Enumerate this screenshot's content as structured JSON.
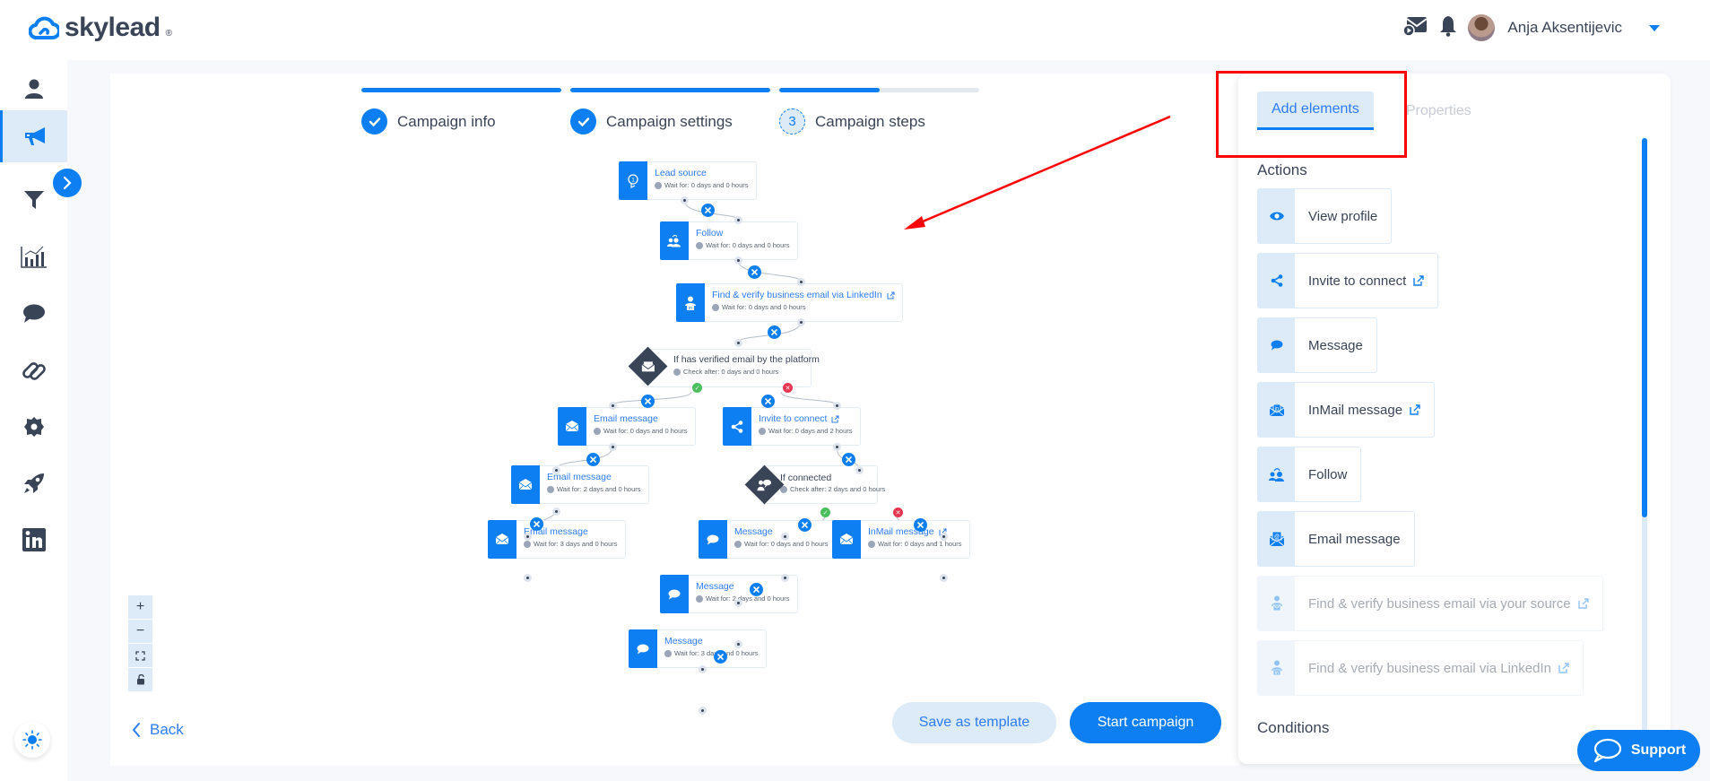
{
  "header": {
    "brand": "skylead",
    "brand_mark": "®",
    "user_name": "Anja Aksentijevic",
    "icons": [
      "mail-play-icon",
      "bell-icon",
      "avatar",
      "chevron-down-icon"
    ]
  },
  "sidebar": {
    "items": [
      {
        "name": "profile",
        "icon": "user-icon",
        "active": false
      },
      {
        "name": "campaigns",
        "icon": "megaphone-icon",
        "active": true
      },
      {
        "name": "filters",
        "icon": "funnel-icon",
        "active": false
      },
      {
        "name": "statistics",
        "icon": "chart-icon",
        "active": false
      },
      {
        "name": "inbox",
        "icon": "chat-icon",
        "active": false
      },
      {
        "name": "integrations",
        "icon": "paperclip-icon",
        "active": false
      },
      {
        "name": "settings",
        "icon": "gear-icon",
        "active": false
      },
      {
        "name": "launch",
        "icon": "rocket-icon",
        "active": false
      },
      {
        "name": "linkedin",
        "icon": "linkedin-icon",
        "active": false
      }
    ],
    "toggle_icon": "chevron-right-icon",
    "theme_icon": "sun-icon"
  },
  "stepper": {
    "steps": [
      {
        "label": "Campaign info",
        "state": "done",
        "progress": 1.0
      },
      {
        "label": "Campaign settings",
        "state": "done",
        "progress": 1.0
      },
      {
        "label": "Campaign steps",
        "state": "current",
        "number": "3",
        "progress": 0.5
      }
    ]
  },
  "flow": {
    "nodes": [
      {
        "id": "lead",
        "type": "action",
        "title": "Lead source",
        "sub": "Wait for: 0 days and 0 hours",
        "icon": "badge-icon",
        "external": false
      },
      {
        "id": "follow",
        "type": "action",
        "title": "Follow",
        "sub": "Wait for: 0 days and 0 hours",
        "icon": "follow-icon",
        "external": false
      },
      {
        "id": "findli",
        "type": "action",
        "title": "Find & verify business email via LinkedIn",
        "sub": "Wait for: 0 days and 0 hours",
        "icon": "person-linkedin-icon",
        "external": true
      },
      {
        "id": "ifemail",
        "type": "condition",
        "title": "If has verified email by the platform",
        "sub": "Check after: 0 days and 0 hours",
        "icon": "envelope-icon"
      },
      {
        "id": "em1",
        "type": "action",
        "title": "Email message",
        "sub": "Wait for: 0 days and 0 hours",
        "icon": "envelope-icon",
        "external": false
      },
      {
        "id": "invite",
        "type": "action",
        "title": "Invite to connect",
        "sub": "Wait for: 0 days and 2 hours",
        "icon": "share-icon",
        "external": true
      },
      {
        "id": "em2",
        "type": "action",
        "title": "Email message",
        "sub": "Wait for: 2 days and 0 hours",
        "icon": "envelope-icon",
        "external": false
      },
      {
        "id": "ifconn",
        "type": "condition",
        "title": "If connected",
        "sub": "Check after: 2 days and 0 hours",
        "icon": "connected-icon"
      },
      {
        "id": "em3",
        "type": "action",
        "title": "Email message",
        "sub": "Wait for: 3 days and 0 hours",
        "icon": "envelope-icon",
        "external": false
      },
      {
        "id": "msg1",
        "type": "action",
        "title": "Message",
        "sub": "Wait for: 0 days and 0 hours",
        "icon": "chat-icon",
        "external": false
      },
      {
        "id": "inmail",
        "type": "action",
        "title": "InMail message",
        "sub": "Wait for: 0 days and 1 hours",
        "icon": "envelope-icon",
        "external": true
      },
      {
        "id": "msg2",
        "type": "action",
        "title": "Message",
        "sub": "Wait for: 2 days and 0 hours",
        "icon": "chat-icon",
        "external": false
      },
      {
        "id": "msg3",
        "type": "action",
        "title": "Message",
        "sub": "Wait for: 3 days and 0 hours",
        "icon": "chat-icon",
        "external": false
      }
    ],
    "zoom_controls": [
      "+",
      "−",
      "fit",
      "lock"
    ]
  },
  "footer": {
    "back_label": "Back",
    "save_template_label": "Save as template",
    "start_label": "Start campaign"
  },
  "panel": {
    "tabs": [
      {
        "label": "Add elements",
        "active": true
      },
      {
        "label": "Properties",
        "active": false
      }
    ],
    "actions_title": "Actions",
    "actions": [
      {
        "label": "View profile",
        "icon": "eye-icon",
        "external": false,
        "disabled": false
      },
      {
        "label": "Invite to connect",
        "icon": "share-icon",
        "external": true,
        "disabled": false
      },
      {
        "label": "Message",
        "icon": "chat-icon",
        "external": false,
        "disabled": false
      },
      {
        "label": "InMail message",
        "icon": "inmail-icon",
        "external": true,
        "disabled": false
      },
      {
        "label": "Follow",
        "icon": "follow-icon",
        "external": false,
        "disabled": false
      },
      {
        "label": "Email message",
        "icon": "email-at-icon",
        "external": false,
        "disabled": false
      },
      {
        "label": "Find & verify business email via your source",
        "icon": "person-mail-icon",
        "external": true,
        "disabled": true
      },
      {
        "label": "Find & verify business email via LinkedIn",
        "icon": "person-linkedin-icon",
        "external": true,
        "disabled": true
      }
    ],
    "conditions_title": "Conditions",
    "scroll_position": 0.0
  },
  "support": {
    "label": "Support"
  },
  "annotation": {
    "highlight_color": "#ff0000"
  },
  "colors": {
    "accent": "#0d7ff3",
    "accent_light": "#dcebf7",
    "text": "#3a4457",
    "success": "#4bbf5e",
    "danger": "#e6364f"
  }
}
